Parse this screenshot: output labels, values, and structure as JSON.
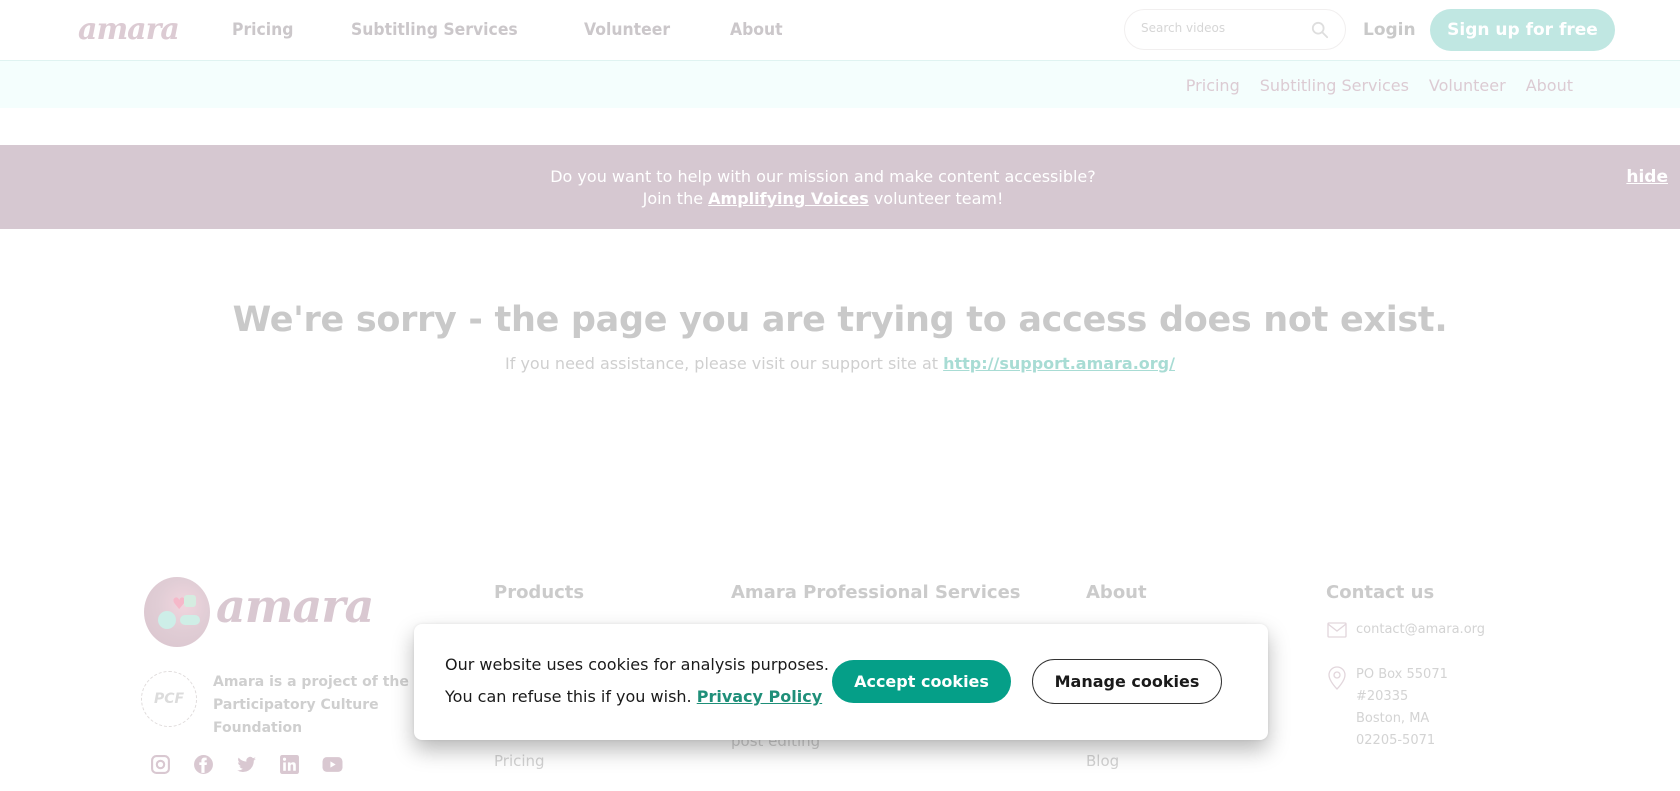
{
  "header": {
    "logo": "amara",
    "nav": [
      "Pricing",
      "Subtitling Services",
      "Volunteer",
      "About"
    ],
    "search_placeholder": "Search videos",
    "login": "Login",
    "signup": "Sign up for free"
  },
  "subnav": [
    "Pricing",
    "Subtitling Services",
    "Volunteer",
    "About"
  ],
  "banner": {
    "line1": "Do you want to help with our mission and make content accessible?",
    "line2_prefix": "Join the ",
    "line2_link": "Amplifying Voices",
    "line2_suffix": " volunteer team!",
    "hide": "hide",
    "bg_color": "#d6c8d1"
  },
  "main": {
    "title": "We're sorry - the page you are trying to access does not exist.",
    "sub_prefix": "If you need assistance, please visit our support site at ",
    "sub_link": "http://support.amara.org/"
  },
  "footer": {
    "logo": "amara",
    "pcf_badge": "PCF",
    "pcf_text": "Amara is a project of the Participatory Culture Foundation",
    "socials": [
      "instagram-icon",
      "facebook-icon",
      "twitter-icon",
      "linkedin-icon",
      "youtube-icon"
    ],
    "columns": [
      {
        "heading": "Products",
        "links": [
          "Pricing"
        ]
      },
      {
        "heading": "Amara Professional Services",
        "links": [
          "post editing"
        ]
      },
      {
        "heading": "About",
        "links": [
          "Blog"
        ]
      }
    ],
    "contact": {
      "heading": "Contact us",
      "email": "contact@amara.org",
      "address": [
        "PO Box 55071",
        "#20335",
        "Boston, MA",
        "02205-5071"
      ]
    }
  },
  "cookie": {
    "line1": "Our website uses cookies for analysis purposes.",
    "line2": "You can refuse this if you wish. ",
    "privacy_link": "Privacy Policy",
    "accept": "Accept cookies",
    "manage": "Manage cookies",
    "accent_color": "#059f88"
  }
}
